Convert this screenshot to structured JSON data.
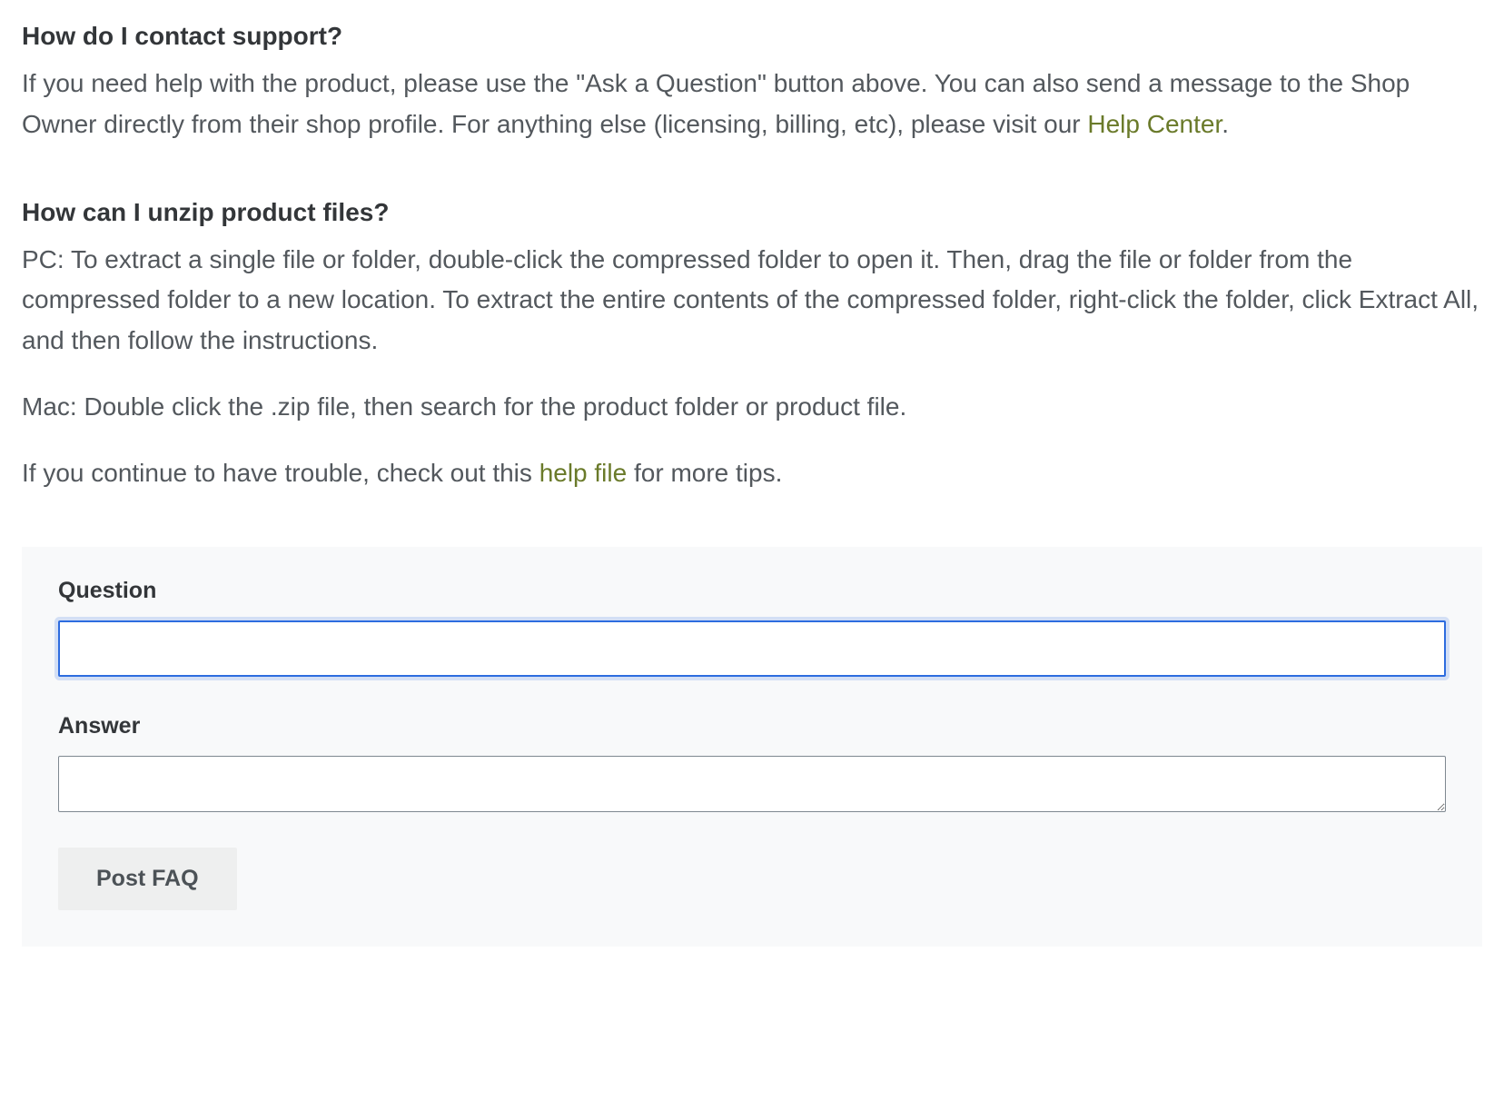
{
  "faq": [
    {
      "heading": "How do I contact support?",
      "paragraphs": [
        [
          {
            "text": "If you need help with the product, please use the \"Ask a Question\" button above. You can also send a message to the Shop Owner directly from their shop profile. For anything else (licensing, billing, etc), please visit our "
          },
          {
            "text": "Help Center",
            "link": true
          },
          {
            "text": "."
          }
        ]
      ]
    },
    {
      "heading": "How can I unzip product files?",
      "paragraphs": [
        [
          {
            "text": "PC: To extract a single file or folder, double-click the compressed folder to open it. Then, drag the file or folder from the compressed folder to a new location. To extract the entire contents of the compressed folder, right-click the folder, click Extract All, and then follow the instructions."
          }
        ],
        [
          {
            "text": "Mac: Double click the .zip file, then search for the product folder or product file."
          }
        ],
        [
          {
            "text": "If you continue to have trouble, check out this "
          },
          {
            "text": "help file",
            "link": true
          },
          {
            "text": " for more tips."
          }
        ]
      ]
    }
  ],
  "form": {
    "question_label": "Question",
    "question_value": "",
    "answer_label": "Answer",
    "answer_value": "",
    "submit_label": "Post FAQ"
  }
}
